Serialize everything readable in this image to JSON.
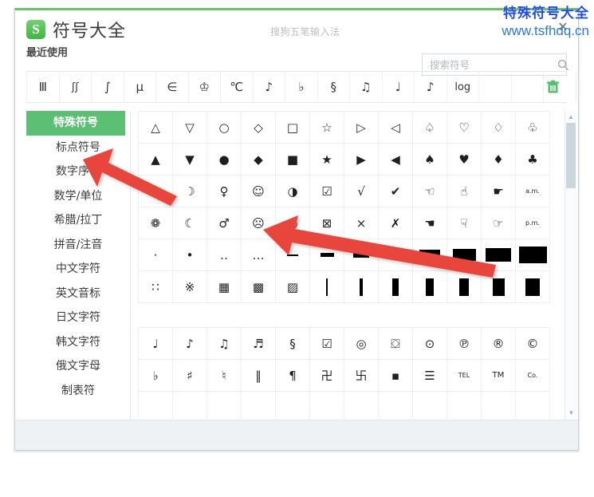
{
  "window": {
    "app_title": "符号大全",
    "logo_letter": "S",
    "ime_name": "搜狗五笔输入法",
    "close_label": "✕",
    "accent_color": "#5cc074",
    "top_border_color": "#6cc06c"
  },
  "watermark": {
    "line1": "特殊符号大全",
    "line2": "www.tsfhdq.cn",
    "color1": "#1f4fd8",
    "color2": "#2f7ad1"
  },
  "search": {
    "placeholder": "搜索符号",
    "value": "",
    "icon": "search-icon"
  },
  "recent": {
    "label": "最近使用",
    "clear_icon": "trash-icon",
    "symbols": [
      "Ⅲ",
      "ʃʃ",
      "∫",
      "μ",
      "∈",
      "♔",
      "℃",
      "♪",
      "♭",
      "§",
      "♫",
      "♩",
      "♪",
      "log",
      "",
      "",
      ""
    ]
  },
  "sidebar": {
    "items": [
      {
        "label": "特殊符号",
        "active": true
      },
      {
        "label": "标点符号",
        "active": false
      },
      {
        "label": "数字序号",
        "active": false
      },
      {
        "label": "数学/单位",
        "active": false
      },
      {
        "label": "希腊/拉丁",
        "active": false
      },
      {
        "label": "拼音/注音",
        "active": false
      },
      {
        "label": "中文字符",
        "active": false
      },
      {
        "label": "英文音标",
        "active": false
      },
      {
        "label": "日文字符",
        "active": false
      },
      {
        "label": "韩文字符",
        "active": false
      },
      {
        "label": "俄文字母",
        "active": false
      },
      {
        "label": "制表符",
        "active": false
      }
    ]
  },
  "grid": {
    "panels": [
      {
        "name": "shapes-panel",
        "rows": [
          [
            "△",
            "▽",
            "○",
            "◇",
            "□",
            "☆",
            "▷",
            "◁",
            "♤",
            "♡",
            "♢",
            "♧"
          ],
          [
            "▲",
            "▼",
            "●",
            "◆",
            "■",
            "★",
            "▶",
            "◀",
            "♠",
            "♥",
            "♦",
            "♣"
          ],
          [
            "☼",
            "☽",
            "♀",
            "☺",
            "◑",
            "☑",
            "√",
            "✔",
            "☜",
            "☝",
            "☛",
            "a.m."
          ],
          [
            "❁",
            "☾",
            "♂",
            "☹",
            "◐",
            "⊠",
            "×",
            "✗",
            "☚",
            "☟",
            "☞",
            "p.m."
          ],
          [
            "·",
            "•",
            "‥",
            "…",
            "▁",
            "▂",
            "▃",
            "▄",
            "▅",
            "▆",
            "▇",
            "█"
          ],
          [
            "∷",
            "※",
            "▦",
            "▩",
            "▨",
            "▏",
            "▎",
            "▍",
            "▌",
            "▋",
            "▊",
            "▉"
          ]
        ]
      },
      {
        "name": "music-marks-panel",
        "rows": [
          [
            "♩",
            "♪",
            "♫",
            "♬",
            "§",
            "☑",
            "◎",
            "⛋",
            "⊙",
            "℗",
            "®",
            "©"
          ],
          [
            "♭",
            "♯",
            "♮",
            "‖",
            "¶",
            "卍",
            "卐",
            "▪",
            "☰",
            "TEL",
            "TM",
            "Co."
          ],
          [
            "",
            "",
            "",
            "",
            "",
            "",
            "",
            "",
            "",
            "",
            "",
            ""
          ]
        ]
      }
    ]
  },
  "scrollbar": {
    "up_arrow": "▲",
    "down_arrow": "▼",
    "thumb_position_percent": 4,
    "thumb_size_percent": 22
  }
}
